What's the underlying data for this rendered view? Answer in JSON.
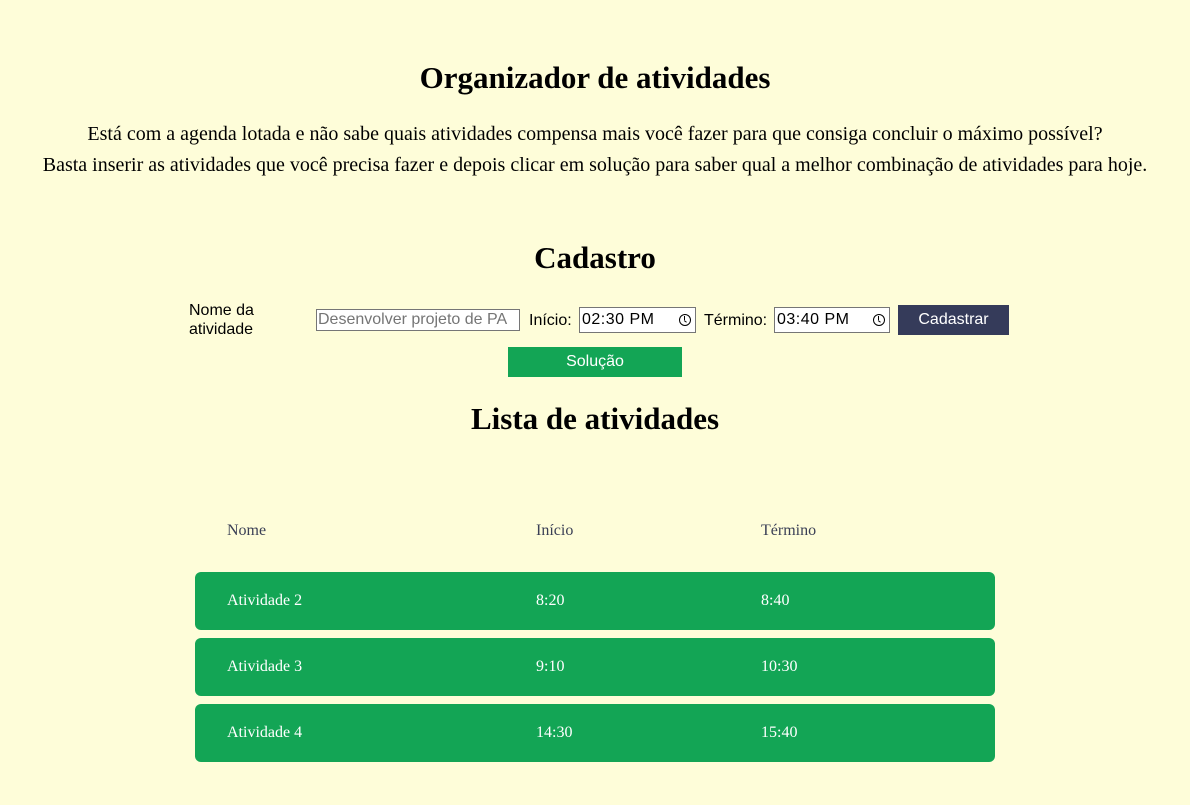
{
  "header": {
    "title": "Organizador de atividades",
    "intro_line1": "Está com a agenda lotada e não sabe quais atividades compensa mais você fazer para que consiga concluir o máximo possível?",
    "intro_line2": "Basta inserir as atividades que você precisa fazer e depois clicar em solução para saber qual a melhor combinação de atividades para hoje."
  },
  "form": {
    "title": "Cadastro",
    "name_label": "Nome da atividade",
    "name_placeholder": "Desenvolver projeto de PA",
    "name_value": "",
    "start_label": "Início:",
    "start_value": "02:30 PM",
    "end_label": "Término:",
    "end_value": "03:40 PM",
    "submit_label": "Cadastrar",
    "solve_label": "Solução"
  },
  "list": {
    "title": "Lista de atividades",
    "columns": {
      "name": "Nome",
      "start": "Início",
      "end": "Término"
    },
    "rows": [
      {
        "name": "Atividade 2",
        "start": "8:20",
        "end": "8:40"
      },
      {
        "name": "Atividade 3",
        "start": "9:10",
        "end": "10:30"
      },
      {
        "name": "Atividade 4",
        "start": "14:30",
        "end": "15:40"
      }
    ]
  },
  "colors": {
    "background": "#fefdd9",
    "primary_green": "#13a555",
    "dark_button": "#353b5a"
  }
}
